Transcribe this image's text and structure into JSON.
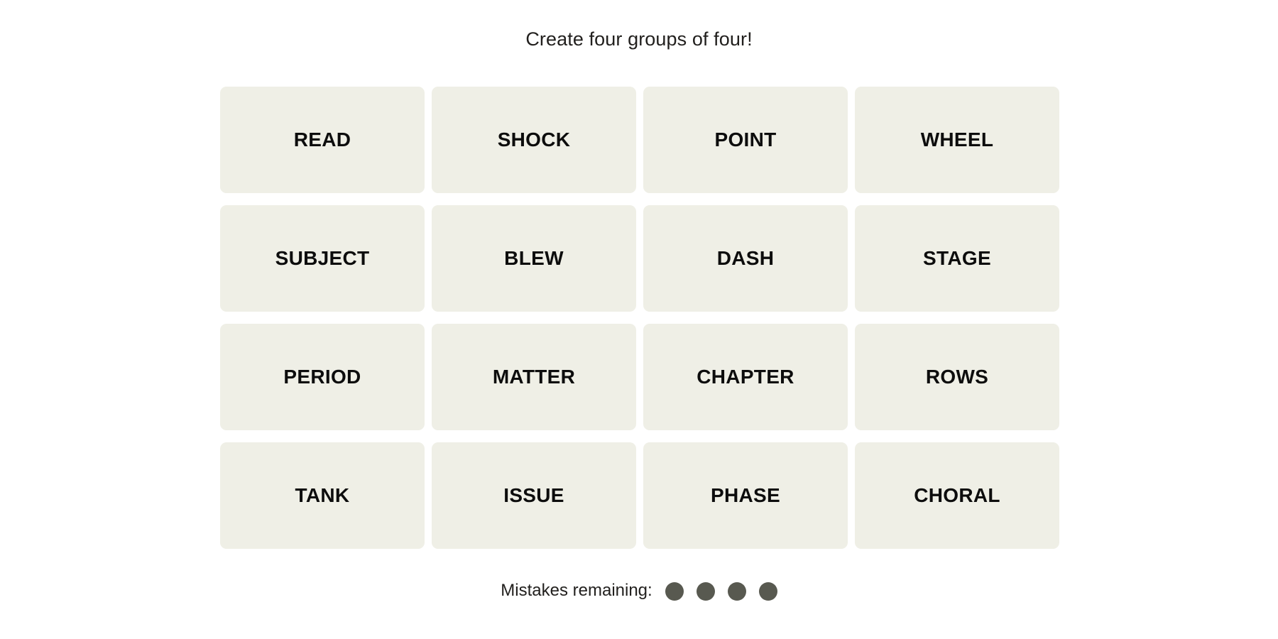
{
  "header": {
    "instruction": "Create four groups of four!"
  },
  "board": {
    "rows": [
      {
        "tiles": [
          {
            "label": "READ"
          },
          {
            "label": "SHOCK"
          },
          {
            "label": "POINT"
          },
          {
            "label": "WHEEL"
          }
        ]
      },
      {
        "tiles": [
          {
            "label": "SUBJECT"
          },
          {
            "label": "BLEW"
          },
          {
            "label": "DASH"
          },
          {
            "label": "STAGE"
          }
        ]
      },
      {
        "tiles": [
          {
            "label": "PERIOD"
          },
          {
            "label": "MATTER"
          },
          {
            "label": "CHAPTER"
          },
          {
            "label": "ROWS"
          }
        ]
      },
      {
        "tiles": [
          {
            "label": "TANK"
          },
          {
            "label": "ISSUE"
          },
          {
            "label": "PHASE"
          },
          {
            "label": "CHORAL"
          }
        ]
      }
    ]
  },
  "footer": {
    "mistakes_label": "Mistakes remaining:",
    "mistakes_remaining": 4,
    "dots": [
      {
        "name": "mistake-dot-1"
      },
      {
        "name": "mistake-dot-2"
      },
      {
        "name": "mistake-dot-3"
      },
      {
        "name": "mistake-dot-4"
      }
    ]
  },
  "colors": {
    "page_background": "#ffffff",
    "tile_background": "#efefe6",
    "tile_text": "#0d0d0d",
    "title_text": "#22201e",
    "mistake_dot": "#585950"
  }
}
